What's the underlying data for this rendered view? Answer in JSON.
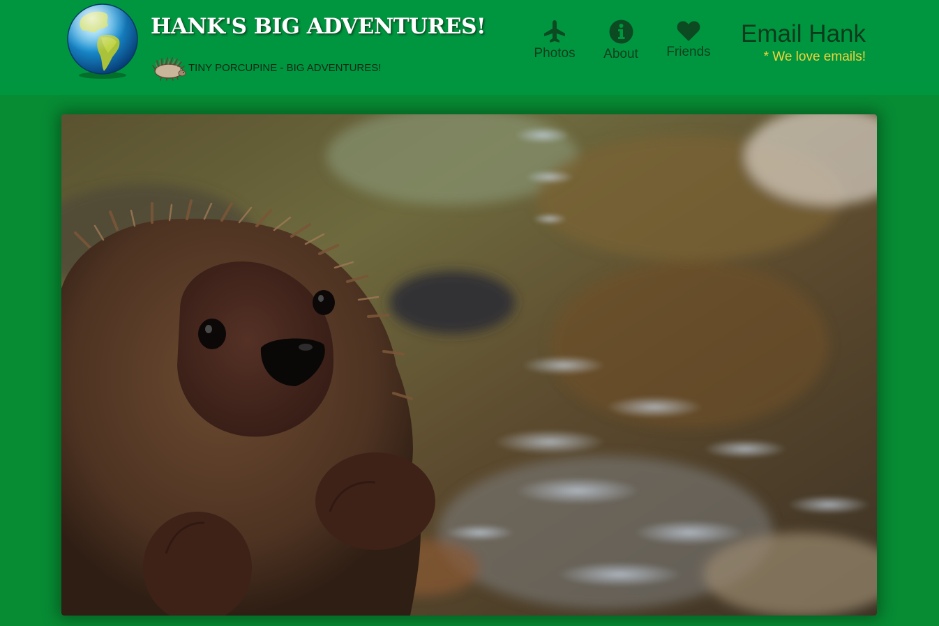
{
  "site": {
    "title": "HANK'S BIG ADVENTURES!",
    "tagline": "TINY PORCUPINE - BIG ADVENTURES!",
    "logo_icon": "globe-icon",
    "tagline_icon": "porcupine-icon"
  },
  "nav": {
    "items": [
      {
        "label": "Photos",
        "icon": "airplane-icon"
      },
      {
        "label": "About",
        "icon": "info-icon"
      },
      {
        "label": "Friends",
        "icon": "heart-icon"
      }
    ],
    "email": {
      "label": "Email Hank",
      "note": "* We love emails!"
    }
  },
  "hero": {
    "subject": "stuffed-porcupine-by-stream-photo"
  },
  "colors": {
    "header_bg": "#009640",
    "page_bg": "#078c34",
    "nav_text": "#0e3f1d",
    "note_accent": "#f5d43a",
    "title_text": "#ffffff"
  }
}
